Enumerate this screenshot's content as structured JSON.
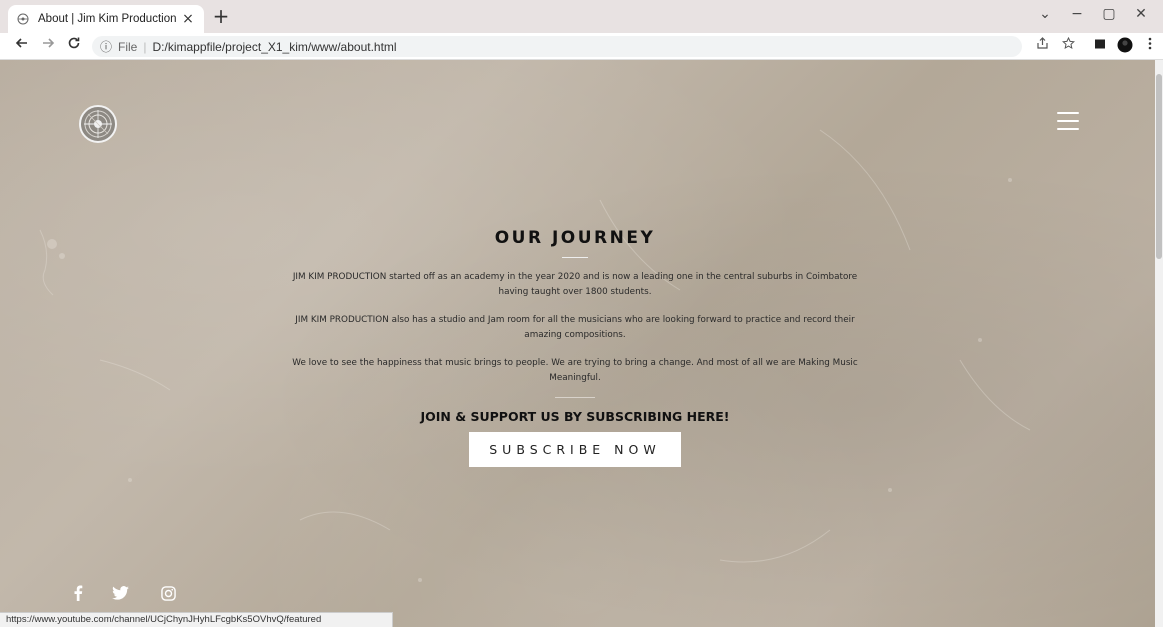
{
  "browser": {
    "tab": {
      "title": "About | Jim Kim Production",
      "close_glyph": "×"
    },
    "new_tab_glyph": "+",
    "window_controls": [
      "⌄",
      "−",
      "▢",
      "✕"
    ],
    "address": {
      "info_glyph": "ⓘ",
      "protocol": "File",
      "separator": "|",
      "url": "D:/kimappfile/project_X1_kim/www/about.html"
    },
    "status_url": "https://www.youtube.com/channel/UCjChynJHyhLFcgbKs5OVhvQ/featured"
  },
  "page": {
    "heading": "OUR JOURNEY",
    "paragraphs": [
      "JIM KIM PRODUCTION started off as an academy in the year 2020 and is now a leading one in the central suburbs in Coimbatore having taught over 1800 students.",
      "JIM KIM PRODUCTION also has a studio and Jam room for all the musicians who are looking forward to practice and record their amazing compositions.",
      "We love to see the happiness that music brings to people. We are trying to bring a change. And most of all we are Making Music Meaningful."
    ],
    "cta_heading": "JOIN & SUPPORT US BY SUBSCRIBING HERE!",
    "subscribe_label": "SUBSCRIBE NOW"
  },
  "icons": {
    "logo": "vinyl-logo-icon",
    "menu": "hamburger-menu-icon",
    "social": [
      "facebook-icon",
      "twitter-icon",
      "instagram-icon"
    ]
  },
  "colors": {
    "background": "#b8ad9f",
    "button_bg": "#ffffff",
    "heading": "#111111"
  }
}
